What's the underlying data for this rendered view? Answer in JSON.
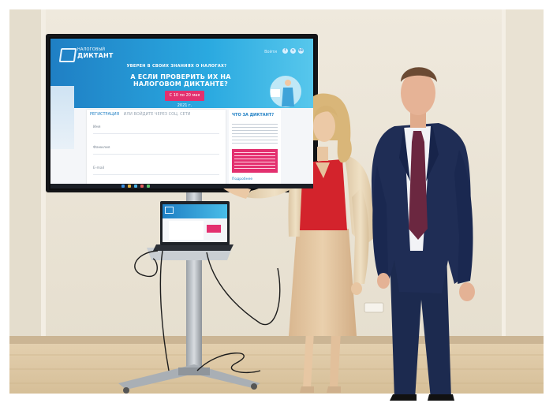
{
  "tv": {
    "logo_top": "НАЛОГОВЫЙ",
    "logo_bottom": "ДИКТАНТ",
    "nav_label": "Войти",
    "social": [
      "f",
      "v",
      "ok"
    ],
    "headline_small": "УВЕРЕН В СВОИХ ЗНАНИЯХ О НАЛОГАХ?",
    "headline": "А ЕСЛИ ПРОВЕРИТЬ ИХ НА НАЛОГОВОМ ДИКТАНТЕ?",
    "date_button": "С 10 по 20 мая 2021 г.",
    "tab_active": "РЕГИСТРАЦИЯ",
    "tab_inactive": "ИЛИ ВОЙДИТЕ ЧЕРЕЗ СОЦ. СЕТИ",
    "field_labels": [
      "Имя",
      "Фамилия",
      "E-mail"
    ],
    "side_title": "ЧТО ЗА ДИКТАНТ?",
    "side_more": "Подробнее"
  },
  "colors": {
    "wall": "#ebe5d7",
    "floor": "#dcc7a6",
    "brand_blue": "#1f7fc4",
    "accent_pink": "#e3306f",
    "dress_red": "#d3232c",
    "suit_navy": "#1c2a4f"
  }
}
